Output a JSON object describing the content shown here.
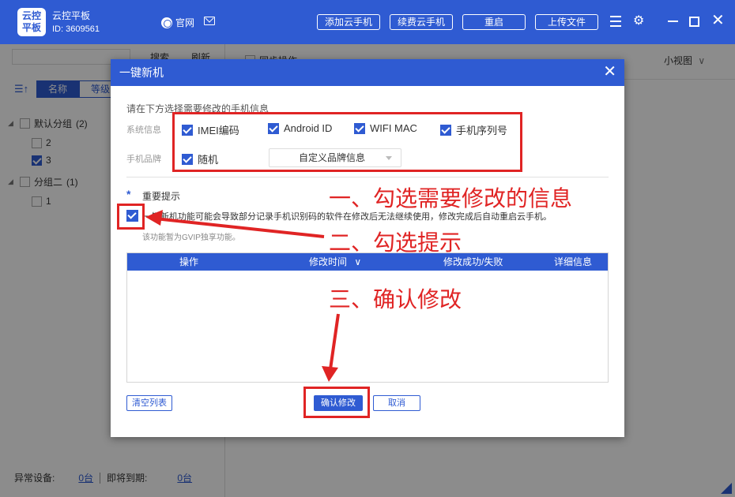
{
  "app": {
    "logo_text": "云控平板",
    "name": "云控平板",
    "id_text": "ID: 3609561",
    "site_link": "官网"
  },
  "toolbar": {
    "add_phone": "添加云手机",
    "renew_phone": "续费云手机",
    "restart": "重启",
    "upload_file": "上传文件"
  },
  "left_panel": {
    "search_btn": "搜索",
    "refresh_btn": "刷新",
    "tabs": [
      "名称",
      "等级"
    ],
    "groups": [
      {
        "name": "默认分组",
        "count": "(2)",
        "items": [
          {
            "label": "2",
            "checked": false
          },
          {
            "label": "3",
            "checked": true
          }
        ]
      },
      {
        "name": "分组二",
        "count": "(1)",
        "items": [
          {
            "label": "1",
            "checked": false
          }
        ]
      }
    ],
    "status": {
      "abnormal_label": "异常设备:",
      "abnormal_value": "0台",
      "expiring_label": "即将到期:",
      "expiring_value": "0台"
    }
  },
  "right_header": {
    "sync_label": "同步操作",
    "view_label": "小视图"
  },
  "modal": {
    "title": "一键新机",
    "instruction": "请在下方选择需要修改的手机信息",
    "system_info_label": "系统信息",
    "brand_label": "手机品牌",
    "options": {
      "imei": "IMEI编码",
      "android_id": "Android ID",
      "wifi_mac": "WIFI MAC",
      "serial": "手机序列号",
      "random": "随机"
    },
    "brand_select": "自定义品牌信息",
    "notice_title": "重要提示",
    "notice_text": "一键新机功能可能会导致部分记录手机识别码的软件在修改后无法继续使用，修改完成后自动重启云手机。",
    "notice_sub": "该功能暂为GVIP独享功能。",
    "table_headers": [
      "操作",
      "修改时间",
      "修改成功/失败",
      "详细信息"
    ],
    "clear_btn": "清空列表",
    "confirm_btn": "确认修改",
    "cancel_btn": "取消"
  },
  "annotations": {
    "step1": "一、勾选需要修改的信息",
    "step2": "二、勾选提示",
    "step3": "三、确认修改"
  },
  "colors": {
    "primary": "#2f5bd2",
    "annotation": "#e02424"
  }
}
